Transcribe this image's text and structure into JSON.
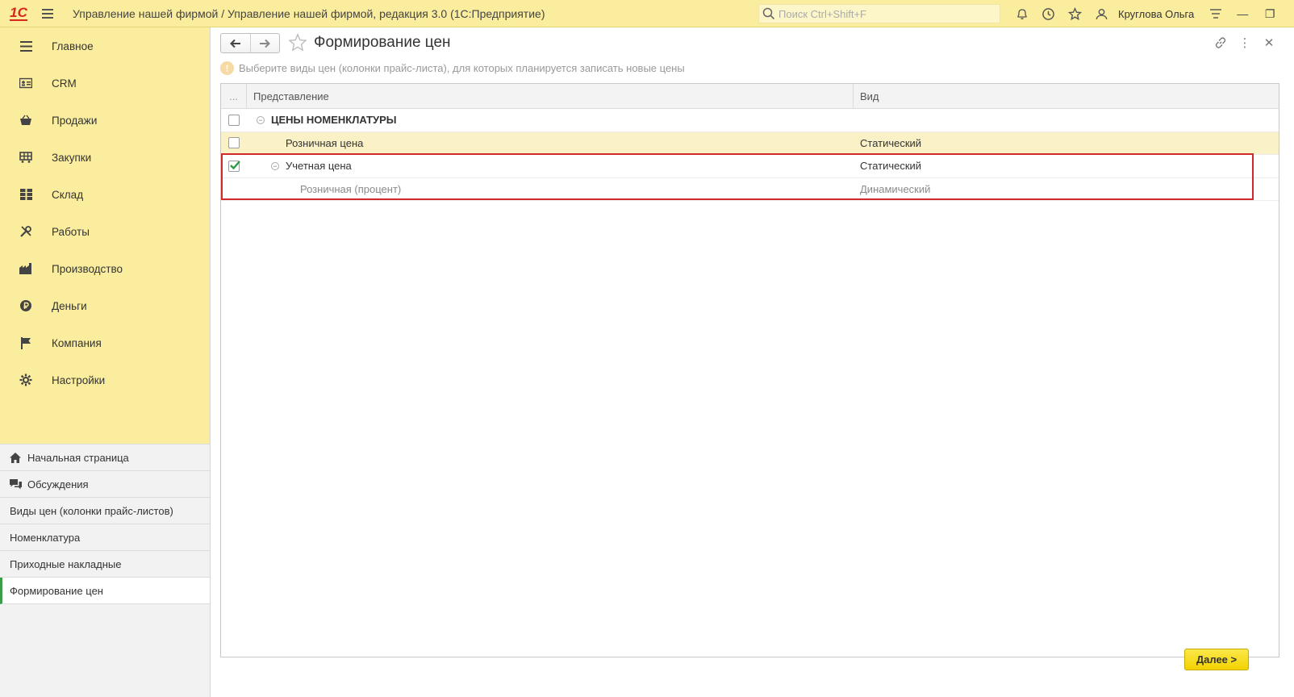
{
  "app": {
    "logo": "1С",
    "title": "Управление нашей фирмой / Управление нашей фирмой, редакция 3.0  (1С:Предприятие)",
    "search_placeholder": "Поиск Ctrl+Shift+F",
    "user": "Круглова Ольга",
    "accent": "#fbed9e"
  },
  "sections": [
    {
      "label": "Главное",
      "icon": "menu-lines-icon"
    },
    {
      "label": "CRM",
      "icon": "contact-card-icon"
    },
    {
      "label": "Продажи",
      "icon": "shopping-basket-icon"
    },
    {
      "label": "Закупки",
      "icon": "purchase-cart-icon"
    },
    {
      "label": "Склад",
      "icon": "warehouse-grid-icon"
    },
    {
      "label": "Работы",
      "icon": "tools-icon"
    },
    {
      "label": "Производство",
      "icon": "factory-icon"
    },
    {
      "label": "Деньги",
      "icon": "ruble-coin-icon"
    },
    {
      "label": "Компания",
      "icon": "flag-icon"
    },
    {
      "label": "Настройки",
      "icon": "gear-icon"
    }
  ],
  "open_windows": [
    {
      "label": "Начальная страница",
      "icon": "home-icon"
    },
    {
      "label": "Обсуждения",
      "icon": "chat-icon"
    },
    {
      "label": "Виды цен (колонки прайс-листов)"
    },
    {
      "label": "Номенклатура"
    },
    {
      "label": "Приходные накладные"
    },
    {
      "label": "Формирование цен",
      "active": true
    }
  ],
  "form": {
    "title": "Формирование цен",
    "hint": "Выберите виды цен (колонки прайс-листа), для которых планируется записать новые цены",
    "hint_icon": "!",
    "columns": {
      "dots": "...",
      "representation": "Представление",
      "kind": "Вид"
    },
    "rows": [
      {
        "repr": "ЦЕНЫ НОМЕНКЛАТУРЫ",
        "kind": "",
        "checked": false,
        "level": 0,
        "group": true
      },
      {
        "repr": "Розничная цена",
        "kind": "Статический",
        "checked": false,
        "level": 1,
        "selected": true
      },
      {
        "repr": "Учетная цена",
        "kind": "Статический",
        "checked": true,
        "level": 1,
        "expandable": true
      },
      {
        "repr": "Розничная (процент)",
        "kind": "Динамический",
        "checked": null,
        "level": 2,
        "dim": true
      }
    ],
    "next_button": "Далее >"
  }
}
